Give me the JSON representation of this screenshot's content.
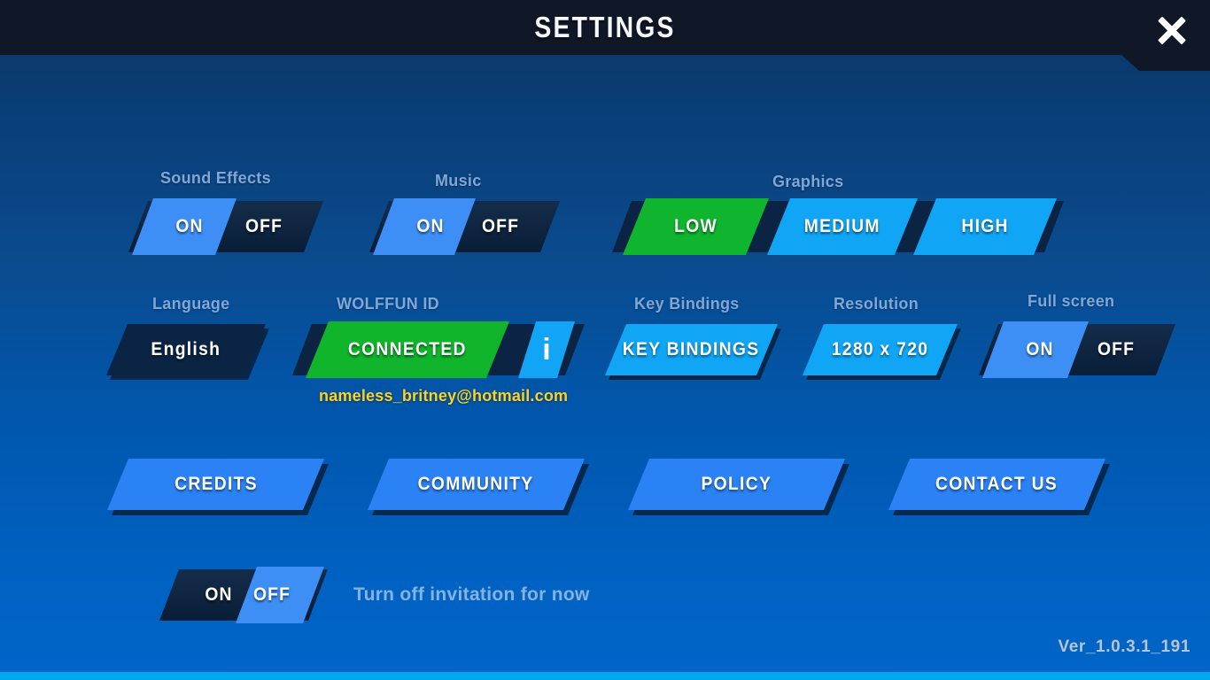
{
  "header": {
    "title": "SETTINGS",
    "close_icon": "close-icon"
  },
  "sound_effects": {
    "label": "Sound Effects",
    "on": "ON",
    "off": "OFF",
    "selected": "ON"
  },
  "music": {
    "label": "Music",
    "on": "ON",
    "off": "OFF",
    "selected": "ON"
  },
  "graphics": {
    "label": "Graphics",
    "options": [
      {
        "label": "LOW",
        "selected": true,
        "color": "#0fb52e"
      },
      {
        "label": "MEDIUM",
        "selected": false,
        "color": "#10a5f5"
      },
      {
        "label": "HIGH",
        "selected": false,
        "color": "#10a5f5"
      }
    ]
  },
  "language": {
    "label": "Language",
    "value": "English"
  },
  "wolffun_id": {
    "label": "WOLFFUN ID",
    "status": "CONNECTED",
    "status_color": "#10b52c",
    "info_icon": "info-icon",
    "info_glyph": "i",
    "email": "nameless_britney@hotmail.com",
    "email_color": "#ffd21e"
  },
  "key_bindings": {
    "label": "Key Bindings",
    "button": "KEY BINDINGS"
  },
  "resolution": {
    "label": "Resolution",
    "value": "1280 x 720"
  },
  "fullscreen": {
    "label": "Full screen",
    "on": "ON",
    "off": "OFF",
    "selected": "ON"
  },
  "links": [
    {
      "label": "CREDITS"
    },
    {
      "label": "COMMUNITY"
    },
    {
      "label": "POLICY"
    },
    {
      "label": "CONTACT US"
    }
  ],
  "invitation": {
    "on": "ON",
    "off": "OFF",
    "selected": "OFF",
    "note": "Turn off invitation for now"
  },
  "footer": {
    "version": "Ver_1.0.3.1_191"
  },
  "colors": {
    "accent_blue": "#10a5f5",
    "button_blue": "#2b82f5",
    "knob_blue": "#3d8ff5",
    "green": "#0fb52e",
    "dark_panel": "#0b2443",
    "header_bg": "#101726",
    "label_blue": "#7fa7d8",
    "bottom_strip": "#00a8f0"
  }
}
